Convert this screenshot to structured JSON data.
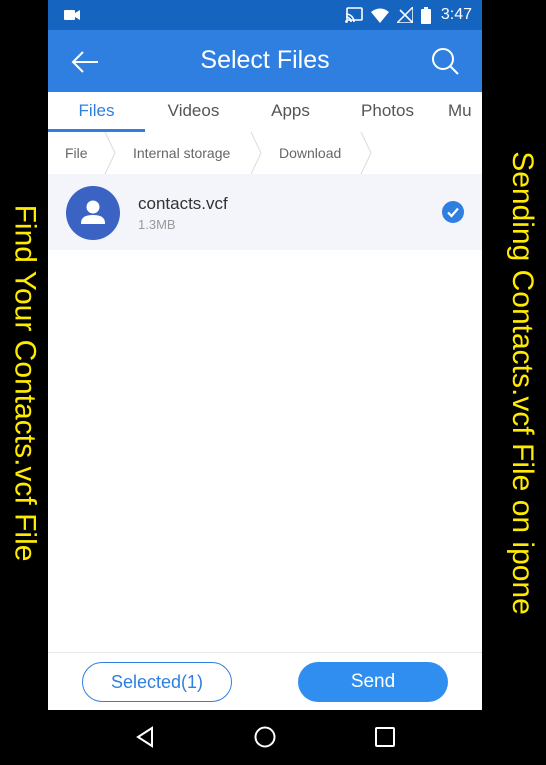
{
  "captions": {
    "left": "Find Your Contacts.vcf File",
    "right": "Sending Contacts.vcf File on ipone"
  },
  "status_bar": {
    "time": "3:47",
    "icons": [
      "video-camera-icon",
      "cast-icon",
      "wifi-icon",
      "no-sim-icon",
      "battery-icon"
    ],
    "color": "#1565c0"
  },
  "app_bar": {
    "title": "Select Files",
    "color": "#2f7fe0",
    "icons": [
      "back-arrow-icon",
      "search-icon"
    ]
  },
  "tabs": [
    {
      "label": "Files",
      "active": true
    },
    {
      "label": "Videos",
      "active": false
    },
    {
      "label": "Apps",
      "active": false
    },
    {
      "label": "Photos",
      "active": false
    },
    {
      "label": "Mu",
      "active": false
    }
  ],
  "breadcrumb": [
    "File",
    "Internal storage",
    "Download"
  ],
  "files": [
    {
      "name": "contacts.vcf",
      "size": "1.3MB",
      "icon": "contact-avatar-icon",
      "selected": true
    }
  ],
  "bottom_bar": {
    "selected_label": "Selected(1)",
    "send_label": "Send"
  },
  "nav_bar": {
    "icons": [
      "back-triangle-icon",
      "home-circle-icon",
      "recents-square-icon"
    ]
  }
}
